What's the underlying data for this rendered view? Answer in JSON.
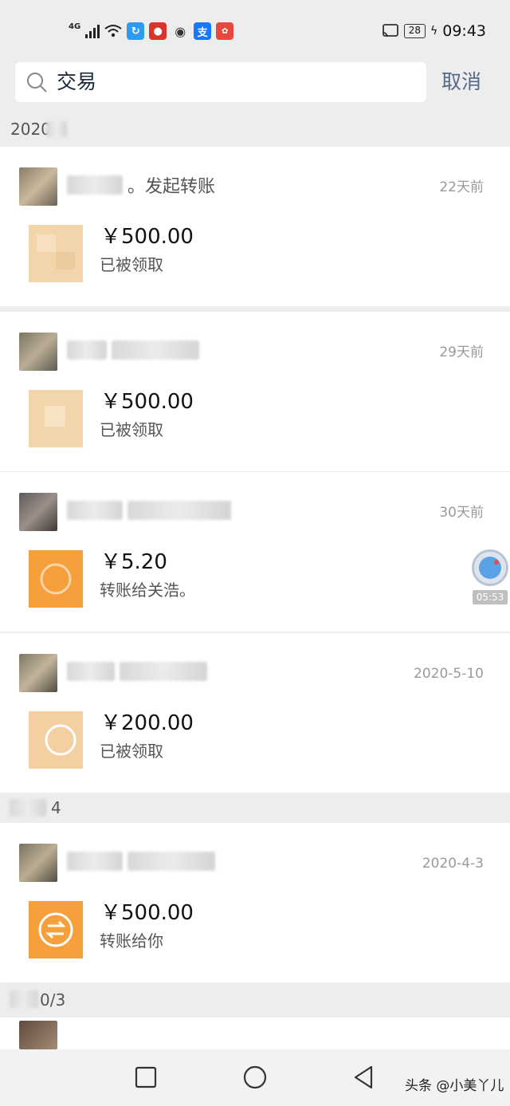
{
  "status_bar": {
    "network": "4G",
    "battery": "28",
    "time": "09:43"
  },
  "search": {
    "query": "交易",
    "cancel_label": "取消"
  },
  "groups": [
    {
      "label": "2020"
    },
    {
      "label": "4"
    },
    {
      "label": "0/3"
    }
  ],
  "transactions": [
    {
      "title": "。发起转账",
      "time": "22天前",
      "amount": "￥500.00",
      "status": "已被领取",
      "thumb_icon": "check-icon"
    },
    {
      "title": "",
      "time": "29天前",
      "amount": "￥500.00",
      "status": "已被领取",
      "thumb_icon": "check-icon"
    },
    {
      "title": "",
      "time": "30天前",
      "amount": "￥5.20",
      "status": "转账给关浩。",
      "thumb_icon": "transfer-icon"
    },
    {
      "title": "",
      "time": "2020-5-10",
      "amount": "￥200.00",
      "status": "已被领取",
      "thumb_icon": "check-icon"
    },
    {
      "title": "",
      "time": "2020-4-3",
      "amount": "￥500.00",
      "status": "转账给你",
      "thumb_icon": "transfer-icon"
    }
  ],
  "floating_timer": {
    "label": "05:53"
  },
  "watermark": "头条 @小美丫儿",
  "colors": {
    "background": "#ededed",
    "card": "#ffffff",
    "accent_link": "#55698a",
    "transfer_orange": "#f5a03c",
    "received_pale": "#f7d9b2"
  }
}
